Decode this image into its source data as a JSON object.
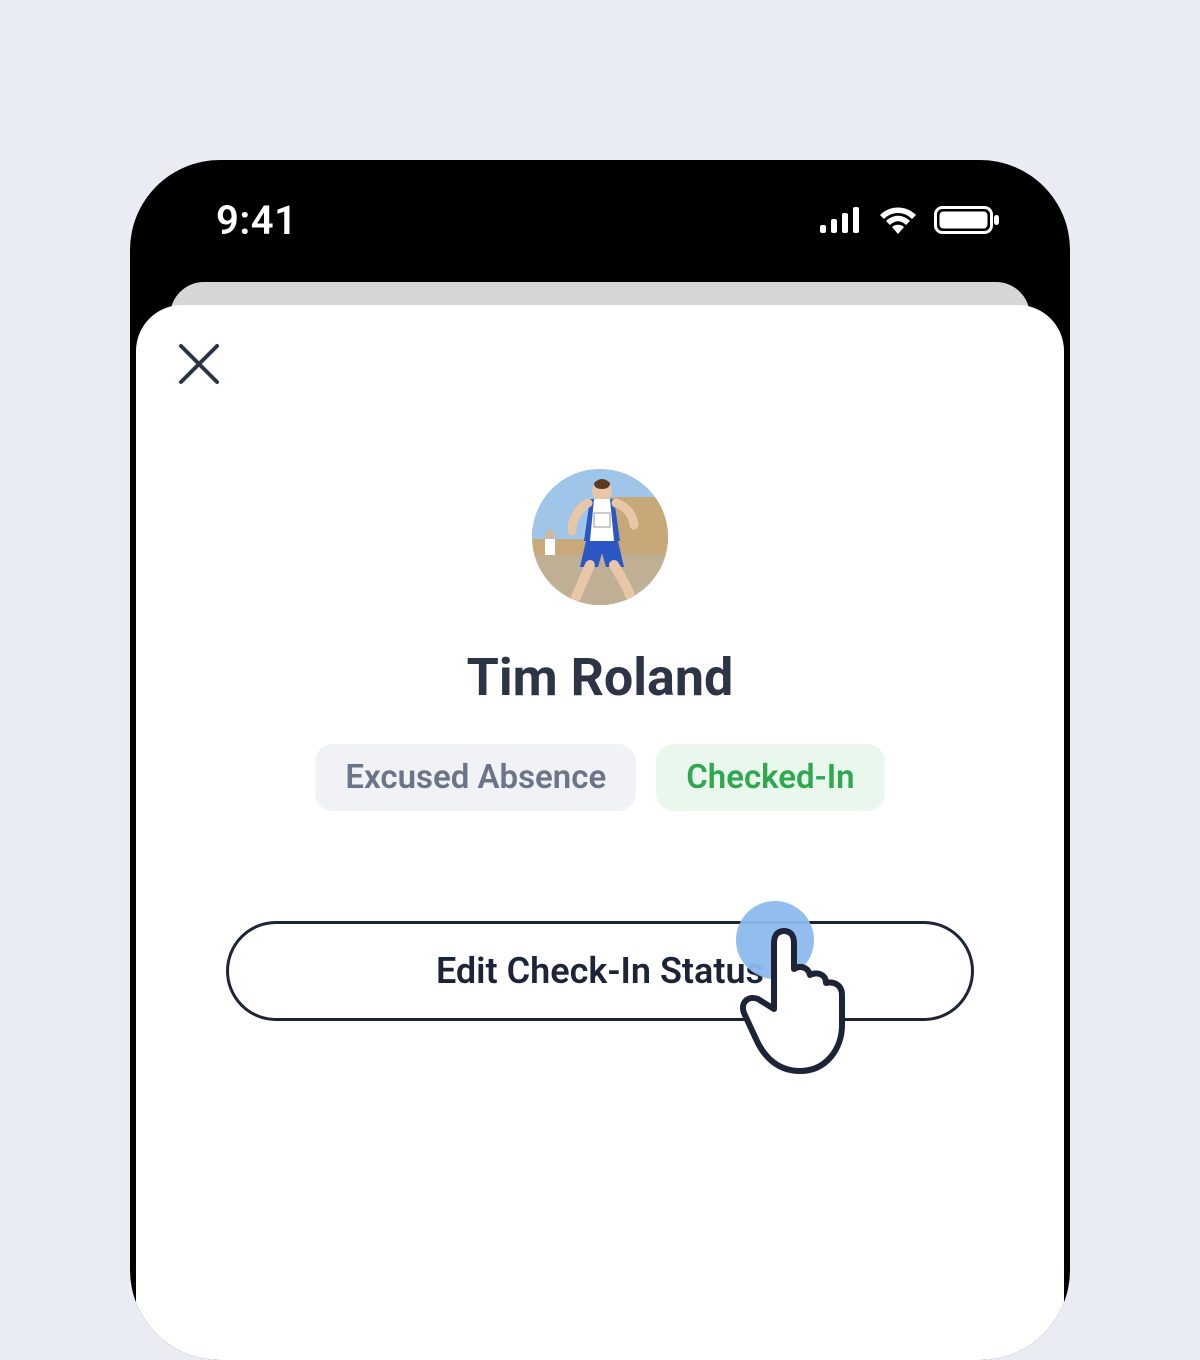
{
  "statusbar": {
    "time": "9:41"
  },
  "profile": {
    "name": "Tim Roland",
    "badges": {
      "absence": "Excused Absence",
      "checked_in": "Checked-In"
    }
  },
  "actions": {
    "edit_status": "Edit Check-In Status"
  }
}
